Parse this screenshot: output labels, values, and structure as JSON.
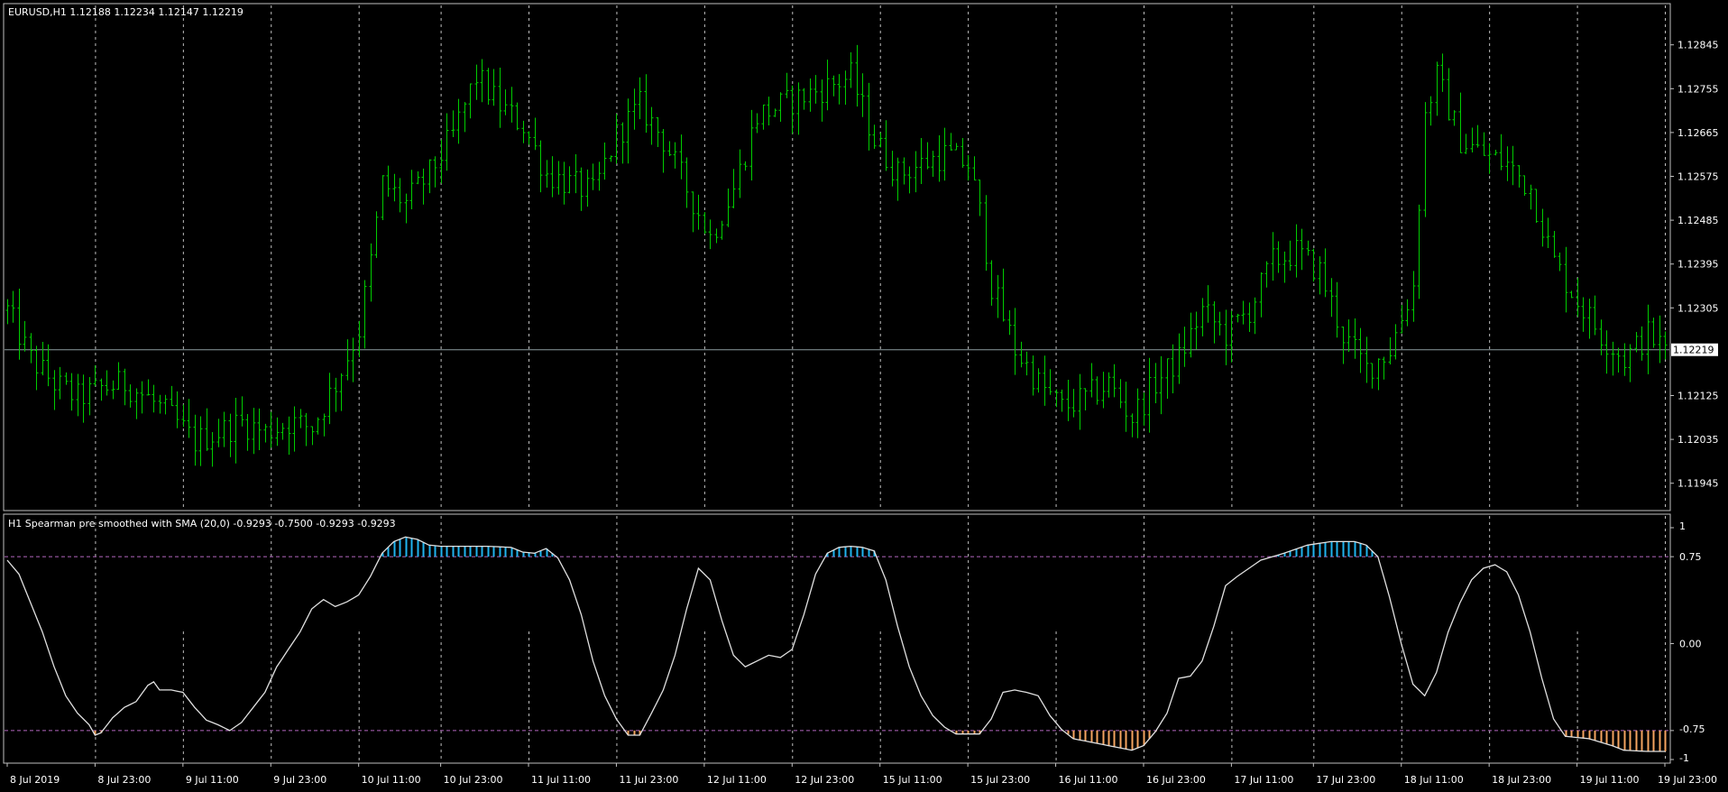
{
  "colors": {
    "background": "#000000",
    "frame": "#c0c0c0",
    "text": "#ffffff",
    "price_bars": "#00cc00",
    "grid": "#ffffff",
    "price_line": "#8c9ca0",
    "indicator_line": "#e0e0e0",
    "level_line": "#b266c0",
    "hist_up": "#1fb4ef",
    "hist_down": "#f4a460"
  },
  "chart_data": [
    {
      "type": "ohlc",
      "header": "EURUSD,H1  1.12188 1.12234 1.12147 1.12219",
      "symbol": "EURUSD",
      "timeframe": "H1",
      "ohlc_last": {
        "open": "1.12188",
        "high": "1.12234",
        "low": "1.12147",
        "close": "1.12219"
      },
      "y_ticks": [
        "1.12845",
        "1.12755",
        "1.12665",
        "1.12575",
        "1.12485",
        "1.12395",
        "1.12305",
        "1.12125",
        "1.12035",
        "1.11945"
      ],
      "ylim": [
        1.119,
        1.129
      ],
      "current_price": 1.12219,
      "current_price_label": "1.12219",
      "x_ticks": [
        "8 Jul 2019",
        "8 Jul 23:00",
        "9 Jul 11:00",
        "9 Jul 23:00",
        "10 Jul 11:00",
        "10 Jul 23:00",
        "11 Jul 11:00",
        "11 Jul 23:00",
        "12 Jul 11:00",
        "12 Jul 23:00",
        "15 Jul 11:00",
        "15 Jul 23:00",
        "16 Jul 11:00",
        "16 Jul 23:00",
        "17 Jul 11:00",
        "17 Jul 23:00",
        "18 Jul 11:00",
        "18 Jul 23:00",
        "19 Jul 11:00",
        "19 Jul 23:00"
      ],
      "close_path": [
        [
          0,
          1.123
        ],
        [
          4,
          1.122
        ],
        [
          8,
          1.1215
        ],
        [
          12,
          1.1212
        ],
        [
          16,
          1.1214
        ],
        [
          20,
          1.1215
        ],
        [
          24,
          1.1212
        ],
        [
          28,
          1.1208
        ],
        [
          32,
          1.1203
        ],
        [
          36,
          1.1205
        ],
        [
          40,
          1.1207
        ],
        [
          44,
          1.1205
        ],
        [
          48,
          1.1207
        ],
        [
          52,
          1.1206
        ],
        [
          56,
          1.1215
        ],
        [
          60,
          1.1226
        ],
        [
          62,
          1.124
        ],
        [
          64,
          1.1256
        ],
        [
          68,
          1.1252
        ],
        [
          72,
          1.1258
        ],
        [
          76,
          1.1266
        ],
        [
          80,
          1.1278
        ],
        [
          84,
          1.1272
        ],
        [
          88,
          1.1268
        ],
        [
          92,
          1.1258
        ],
        [
          96,
          1.1256
        ],
        [
          100,
          1.1254
        ],
        [
          104,
          1.1266
        ],
        [
          108,
          1.1272
        ],
        [
          112,
          1.1265
        ],
        [
          116,
          1.1255
        ],
        [
          120,
          1.1245
        ],
        [
          124,
          1.1255
        ],
        [
          128,
          1.127
        ],
        [
          132,
          1.1272
        ],
        [
          136,
          1.1274
        ],
        [
          140,
          1.1276
        ],
        [
          144,
          1.1278
        ],
        [
          148,
          1.1265
        ],
        [
          152,
          1.1258
        ],
        [
          156,
          1.126
        ],
        [
          160,
          1.1262
        ],
        [
          164,
          1.126
        ],
        [
          166,
          1.125
        ],
        [
          168,
          1.1235
        ],
        [
          172,
          1.1222
        ],
        [
          176,
          1.1215
        ],
        [
          180,
          1.121
        ],
        [
          184,
          1.1212
        ],
        [
          188,
          1.1215
        ],
        [
          192,
          1.1208
        ],
        [
          196,
          1.1215
        ],
        [
          200,
          1.122
        ],
        [
          204,
          1.123
        ],
        [
          208,
          1.1225
        ],
        [
          212,
          1.123
        ],
        [
          216,
          1.124
        ],
        [
          220,
          1.1242
        ],
        [
          224,
          1.1238
        ],
        [
          228,
          1.1225
        ],
        [
          232,
          1.1218
        ],
        [
          236,
          1.1222
        ],
        [
          240,
          1.1235
        ],
        [
          242,
          1.127
        ],
        [
          244,
          1.1278
        ],
        [
          248,
          1.1265
        ],
        [
          252,
          1.1262
        ],
        [
          256,
          1.126
        ],
        [
          260,
          1.1255
        ],
        [
          264,
          1.124
        ],
        [
          268,
          1.1232
        ],
        [
          272,
          1.1225
        ],
        [
          276,
          1.122
        ],
        [
          280,
          1.1225
        ],
        [
          283,
          1.1222
        ]
      ]
    },
    {
      "type": "line",
      "header": "H1 Spearman pre smoothed with SMA (20,0) -0.9293 -0.7500 -0.9293 -0.9293",
      "indicator": "Spearman pre smoothed with SMA",
      "params": "(20,0)",
      "values_shown": [
        "-0.9293",
        "-0.7500",
        "-0.9293",
        "-0.9293"
      ],
      "y_ticks": [
        "1",
        "0.75",
        "0.00",
        "-0.75",
        "-1"
      ],
      "ylim": [
        -1.0,
        1.0
      ],
      "levels": [
        0.75,
        -0.75
      ],
      "series": [
        {
          "points": [
            [
              0,
              0.72
            ],
            [
              2,
              0.6
            ],
            [
              4,
              0.35
            ],
            [
              6,
              0.1
            ],
            [
              8,
              -0.2
            ],
            [
              10,
              -0.45
            ],
            [
              12,
              -0.6
            ],
            [
              14,
              -0.7
            ],
            [
              15,
              -0.79
            ],
            [
              16,
              -0.77
            ],
            [
              18,
              -0.64
            ],
            [
              20,
              -0.55
            ],
            [
              22,
              -0.5
            ],
            [
              24,
              -0.36
            ],
            [
              25,
              -0.33
            ],
            [
              26,
              -0.4
            ],
            [
              28,
              -0.4
            ],
            [
              30,
              -0.42
            ],
            [
              32,
              -0.55
            ],
            [
              34,
              -0.66
            ],
            [
              36,
              -0.7
            ],
            [
              38,
              -0.75
            ],
            [
              40,
              -0.68
            ],
            [
              42,
              -0.55
            ],
            [
              44,
              -0.42
            ],
            [
              46,
              -0.2
            ],
            [
              48,
              -0.05
            ],
            [
              50,
              0.1
            ],
            [
              52,
              0.3
            ],
            [
              54,
              0.38
            ],
            [
              56,
              0.32
            ],
            [
              58,
              0.36
            ],
            [
              60,
              0.42
            ],
            [
              62,
              0.58
            ],
            [
              64,
              0.78
            ],
            [
              66,
              0.88
            ],
            [
              68,
              0.92
            ],
            [
              70,
              0.9
            ],
            [
              72,
              0.85
            ],
            [
              74,
              0.84
            ],
            [
              78,
              0.84
            ],
            [
              82,
              0.84
            ],
            [
              86,
              0.83
            ],
            [
              88,
              0.79
            ],
            [
              90,
              0.78
            ],
            [
              92,
              0.82
            ],
            [
              94,
              0.74
            ],
            [
              96,
              0.55
            ],
            [
              98,
              0.25
            ],
            [
              100,
              -0.15
            ],
            [
              102,
              -0.45
            ],
            [
              104,
              -0.65
            ],
            [
              106,
              -0.79
            ],
            [
              108,
              -0.79
            ],
            [
              110,
              -0.6
            ],
            [
              112,
              -0.4
            ],
            [
              114,
              -0.1
            ],
            [
              116,
              0.3
            ],
            [
              118,
              0.65
            ],
            [
              120,
              0.55
            ],
            [
              122,
              0.2
            ],
            [
              124,
              -0.1
            ],
            [
              126,
              -0.2
            ],
            [
              128,
              -0.15
            ],
            [
              130,
              -0.1
            ],
            [
              132,
              -0.12
            ],
            [
              134,
              -0.05
            ],
            [
              136,
              0.25
            ],
            [
              138,
              0.6
            ],
            [
              140,
              0.78
            ],
            [
              142,
              0.83
            ],
            [
              144,
              0.84
            ],
            [
              146,
              0.83
            ],
            [
              148,
              0.8
            ],
            [
              150,
              0.55
            ],
            [
              152,
              0.15
            ],
            [
              154,
              -0.2
            ],
            [
              156,
              -0.45
            ],
            [
              158,
              -0.62
            ],
            [
              160,
              -0.72
            ],
            [
              162,
              -0.78
            ],
            [
              164,
              -0.78
            ],
            [
              166,
              -0.78
            ],
            [
              168,
              -0.65
            ],
            [
              170,
              -0.42
            ],
            [
              172,
              -0.4
            ],
            [
              174,
              -0.42
            ],
            [
              176,
              -0.45
            ],
            [
              178,
              -0.62
            ],
            [
              180,
              -0.74
            ],
            [
              182,
              -0.82
            ],
            [
              186,
              -0.86
            ],
            [
              190,
              -0.9
            ],
            [
              192,
              -0.92
            ],
            [
              194,
              -0.88
            ],
            [
              196,
              -0.76
            ],
            [
              198,
              -0.6
            ],
            [
              200,
              -0.3
            ],
            [
              202,
              -0.28
            ],
            [
              204,
              -0.15
            ],
            [
              206,
              0.15
            ],
            [
              208,
              0.5
            ],
            [
              210,
              0.58
            ],
            [
              212,
              0.65
            ],
            [
              214,
              0.72
            ],
            [
              216,
              0.75
            ],
            [
              218,
              0.78
            ],
            [
              222,
              0.85
            ],
            [
              226,
              0.88
            ],
            [
              230,
              0.88
            ],
            [
              232,
              0.85
            ],
            [
              234,
              0.75
            ],
            [
              236,
              0.4
            ],
            [
              238,
              0.0
            ],
            [
              240,
              -0.35
            ],
            [
              242,
              -0.45
            ],
            [
              244,
              -0.25
            ],
            [
              246,
              0.1
            ],
            [
              248,
              0.35
            ],
            [
              250,
              0.55
            ],
            [
              252,
              0.65
            ],
            [
              254,
              0.68
            ],
            [
              256,
              0.62
            ],
            [
              258,
              0.42
            ],
            [
              260,
              0.1
            ],
            [
              262,
              -0.3
            ],
            [
              264,
              -0.65
            ],
            [
              266,
              -0.8
            ],
            [
              270,
              -0.82
            ],
            [
              274,
              -0.88
            ],
            [
              276,
              -0.92
            ],
            [
              280,
              -0.93
            ],
            [
              283,
              -0.93
            ]
          ]
        }
      ]
    }
  ]
}
